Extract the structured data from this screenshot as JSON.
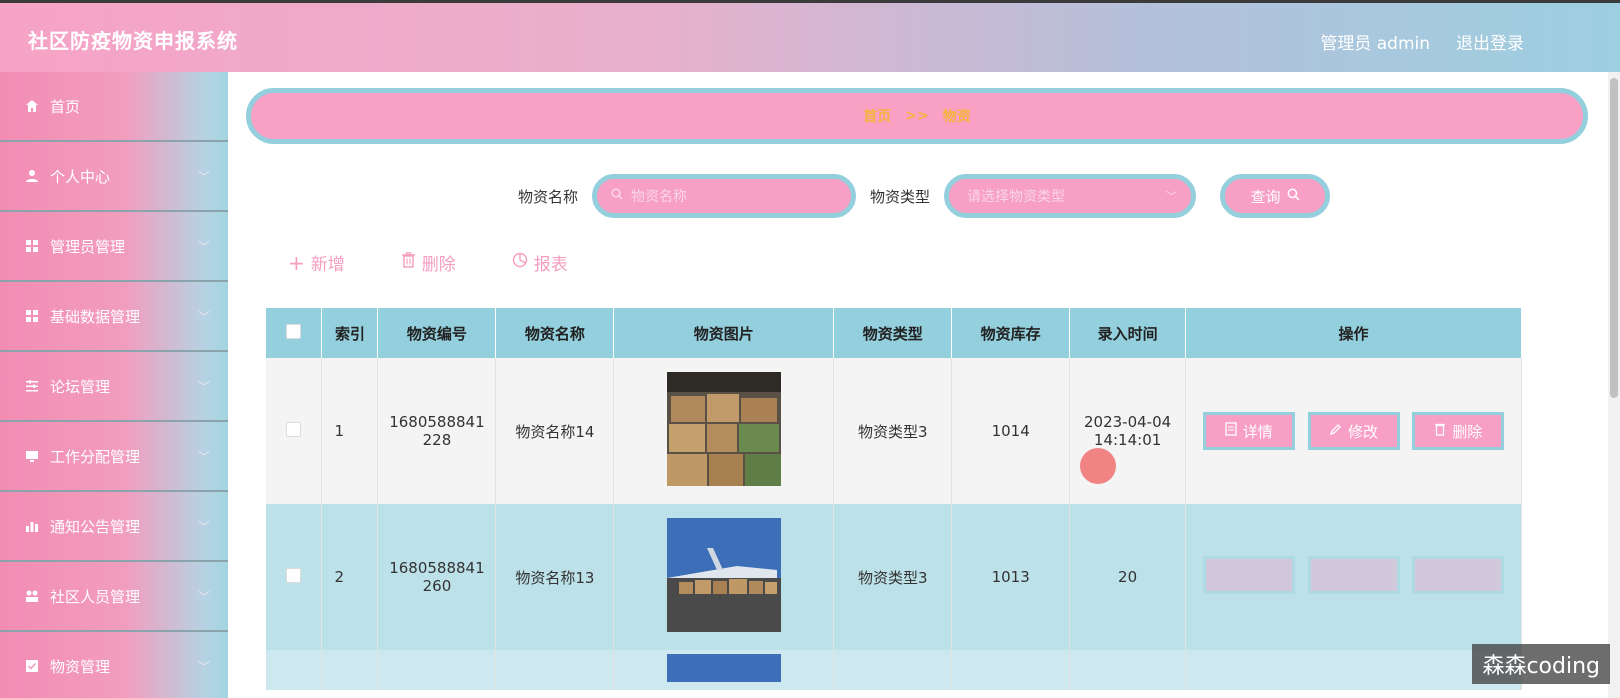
{
  "header": {
    "title": "社区防疫物资申报系统",
    "user_label": "管理员 admin",
    "logout_label": "退出登录"
  },
  "sidebar": {
    "items": [
      {
        "label": "首页",
        "icon": "home-icon"
      },
      {
        "label": "个人中心",
        "icon": "user-icon"
      },
      {
        "label": "管理员管理",
        "icon": "grid-icon"
      },
      {
        "label": "基础数据管理",
        "icon": "grid-icon"
      },
      {
        "label": "论坛管理",
        "icon": "sliders-icon"
      },
      {
        "label": "工作分配管理",
        "icon": "monitor-icon"
      },
      {
        "label": "通知公告管理",
        "icon": "bar-chart-icon"
      },
      {
        "label": "社区人员管理",
        "icon": "people-icon"
      },
      {
        "label": "物资管理",
        "icon": "checkbox-icon"
      }
    ]
  },
  "breadcrumb": {
    "home": "首页",
    "sep": ">>",
    "current": "物资"
  },
  "search": {
    "name_label": "物资名称",
    "name_placeholder": "物资名称",
    "type_label": "物资类型",
    "type_placeholder": "请选择物资类型",
    "query_label": "查询"
  },
  "actions": {
    "add_label": "新增",
    "delete_label": "删除",
    "report_label": "报表"
  },
  "table": {
    "headers": [
      "索引",
      "物资编号",
      "物资名称",
      "物资图片",
      "物资类型",
      "物资库存",
      "录入时间",
      "操作"
    ],
    "rows": [
      {
        "index": "1",
        "code_line1": "1680588841",
        "code_line2": "228",
        "name": "物资名称14",
        "type": "物资类型3",
        "stock": "1014",
        "date": "2023-04-04",
        "time": "14:14:01"
      },
      {
        "index": "2",
        "code_line1": "1680588841",
        "code_line2": "260",
        "name": "物资名称13",
        "type": "物资类型3",
        "stock": "1013",
        "date": "20",
        "time": ""
      }
    ],
    "op_detail": "详情",
    "op_edit": "修改",
    "op_delete": "删除"
  },
  "watermark": "森森coding"
}
